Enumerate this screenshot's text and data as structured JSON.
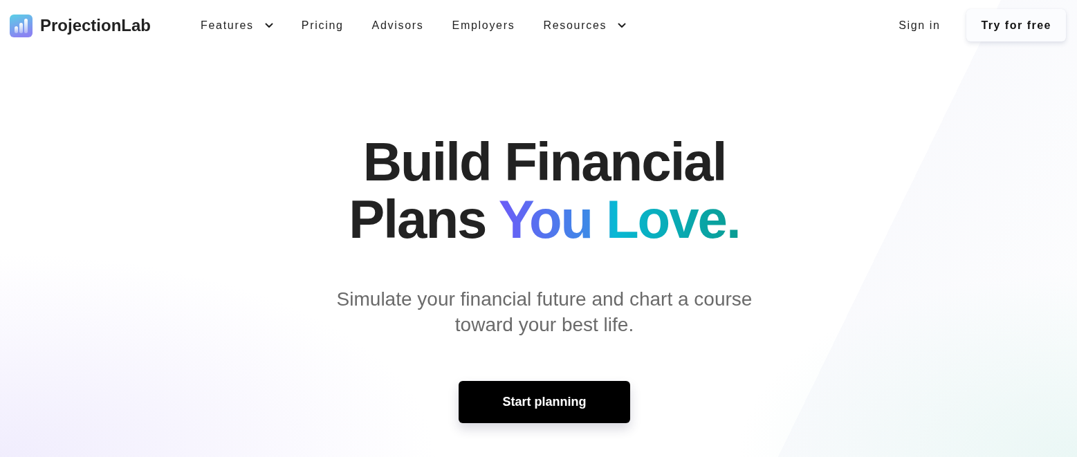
{
  "header": {
    "logo": {
      "wordmark": "ProjectionLab"
    },
    "nav": [
      {
        "label": "Features",
        "dropdown": true
      },
      {
        "label": "Pricing",
        "dropdown": false
      },
      {
        "label": "Advisors",
        "dropdown": false
      },
      {
        "label": "Employers",
        "dropdown": false
      },
      {
        "label": "Resources",
        "dropdown": true
      }
    ],
    "sign_in": "Sign in",
    "cta": "Try for free"
  },
  "hero": {
    "headline": "Build Financial Plans",
    "headline_accent": "You Love.",
    "subtitle": "Simulate your financial future and chart a course toward your best life.",
    "button": "Start planning"
  }
}
